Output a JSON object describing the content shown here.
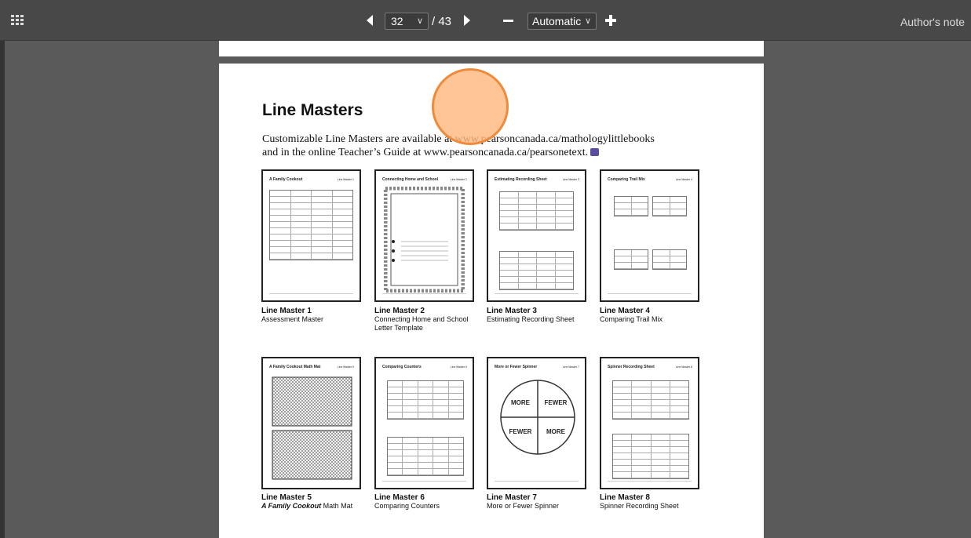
{
  "toolbar": {
    "page_current": "32",
    "page_total": "/ 43",
    "zoom_value": "Automatic",
    "author_note": "Author's note",
    "icons": {
      "grid": "grid-icon",
      "prev": "triangle-left-icon",
      "next": "triangle-right-icon",
      "zoom_out": "minus-icon",
      "zoom_in": "plus-icon",
      "dropdown": "chevron-down-icon"
    }
  },
  "document": {
    "title": "Line Masters",
    "intro_line1": "Customizable Line Masters are available at www.pearsoncanada.ca/mathologylittlebooks",
    "intro_line2": "and in the online Teacher’s Guide at www.pearsoncanada.ca/pearsonetext.",
    "line_masters": [
      {
        "thumb_title": "A Family Cookout",
        "thumb_tag": "Line Master 1",
        "number": "Line Master 1",
        "caption": "Assessment Master"
      },
      {
        "thumb_title": "Connecting Home and School",
        "thumb_tag": "Line Master 2",
        "number": "Line Master 2",
        "caption": "Connecting Home and School Letter Template"
      },
      {
        "thumb_title": "Estimating Recording Sheet",
        "thumb_tag": "Line Master 3",
        "number": "Line Master 3",
        "caption": "Estimating Recording Sheet"
      },
      {
        "thumb_title": "Comparing Trail Mix",
        "thumb_tag": "Line Master 4",
        "number": "Line Master 4",
        "caption": "Comparing Trail Mix"
      },
      {
        "thumb_title": "A Family Cookout Math Mat",
        "thumb_tag": "Line Master 5",
        "number": "Line Master 5",
        "caption_italic": "A Family Cookout",
        "caption": " Math Mat"
      },
      {
        "thumb_title": "Comparing Counters",
        "thumb_tag": "Line Master 6",
        "number": "Line Master 6",
        "caption": "Comparing Counters"
      },
      {
        "thumb_title": "More or Fewer Spinner",
        "thumb_tag": "Line Master 7",
        "number": "Line Master 7",
        "caption": "More or Fewer Spinner",
        "spinner_labels": [
          "MORE",
          "FEWER",
          "FEWER",
          "MORE"
        ]
      },
      {
        "thumb_title": "Spinner Recording Sheet",
        "thumb_tag": "Line Master 8",
        "number": "Line Master 8",
        "caption": "Spinner Recording Sheet"
      }
    ]
  },
  "colors": {
    "toolbar_bg": "#484848",
    "viewer_bg": "#5a5a5a",
    "pointer_fill": "#ffb880",
    "pointer_stroke": "#ef8a3a"
  }
}
